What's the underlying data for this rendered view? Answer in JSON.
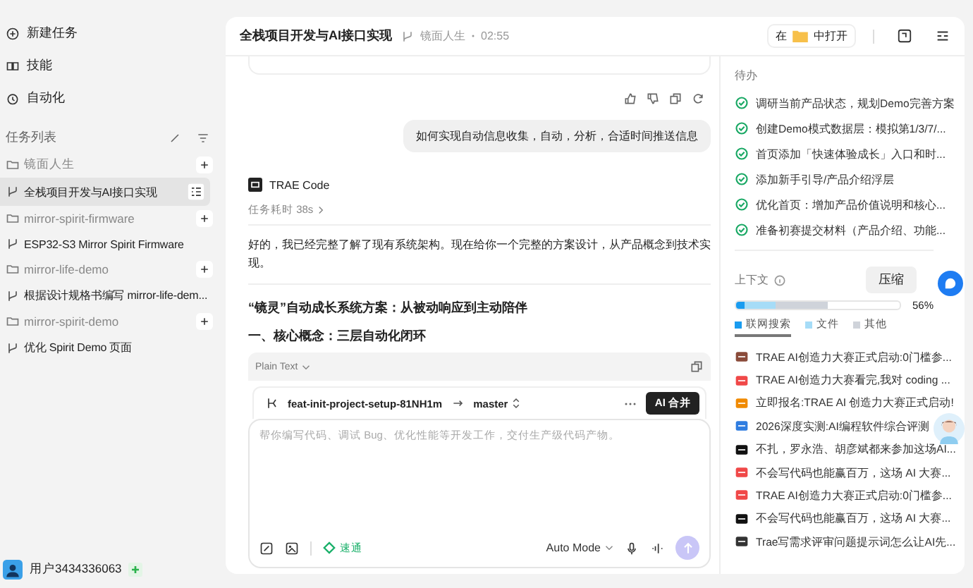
{
  "sidebar": {
    "nav": [
      {
        "label": "新建任务"
      },
      {
        "label": "技能"
      },
      {
        "label": "自动化"
      }
    ],
    "section_title": "任务列表",
    "groups": [
      {
        "name": "镜面人生",
        "tasks": [
          {
            "title": "全栈项目开发与AI接口实现",
            "selected": true
          }
        ]
      },
      {
        "name": "mirror-spirit-firmware",
        "tasks": [
          {
            "title": "ESP32-S3 Mirror Spirit Firmware",
            "selected": false
          }
        ]
      },
      {
        "name": "mirror-life-demo",
        "tasks": [
          {
            "title": "根据设计规格书编写 mirror-life-dem...",
            "selected": false
          }
        ]
      },
      {
        "name": "mirror-spirit-demo",
        "tasks": [
          {
            "title": "优化 Spirit Demo 页面",
            "selected": false
          }
        ]
      }
    ],
    "user": "用户3434336063"
  },
  "header": {
    "title": "全栈项目开发与AI接口实现",
    "project": "镜面人生",
    "time": "02:55",
    "open_in_prefix": "在",
    "open_in_suffix": "中打开"
  },
  "chat": {
    "user_message": "如何实现自动信息收集，自动，分析，合适时间推送信息",
    "agent": "TRAE Code",
    "duration": "任务耗时 38s",
    "reply": "好的，我已经完整了解了现有系统架构。现在给你一个完整的方案设计，从产品概念到技术实现。",
    "heading": "“镜灵”自动成长系统方案：从被动响应到主动陪伴",
    "subheading": "一、核心概念：三层自动化闭环",
    "code_lang": "Plain Text"
  },
  "branch_bar": {
    "branch": "feat-init-project-setup-81NH1m",
    "target": "master",
    "merge_button": "AI 合并"
  },
  "composer": {
    "placeholder": "帮你编写代码、调试 Bug、优化性能等开发工作，交付生产级代码产物。",
    "mode_chip": "速通",
    "mode": "Auto Mode"
  },
  "todos": {
    "title": "待办",
    "items": [
      {
        "text": "调研当前产品状态，规划Demo完善方案",
        "checked": true
      },
      {
        "text": "创建Demo模式数据层：模拟第1/3/7/...",
        "checked": true
      },
      {
        "text": "首页添加「快速体验成长」入口和时...",
        "checked": true
      },
      {
        "text": "添加新手引导/产品介绍浮层",
        "checked": true
      },
      {
        "text": "优化首页：增加产品价值说明和核心...",
        "checked": true
      },
      {
        "text": "准备初赛提交材料（产品介绍、功能...",
        "checked": true
      }
    ]
  },
  "context": {
    "title": "上下文",
    "compress_button": "压缩",
    "percent": "56%",
    "usage_bar": [
      {
        "color": "#1a9cf0",
        "level": 0.05
      },
      {
        "color": "#a6dcf7",
        "level": 0.19
      },
      {
        "color": "#cfd3da",
        "level": 0.32
      }
    ],
    "legend": [
      {
        "label": "联网搜索",
        "color": "#1a9cf0",
        "selected": true
      },
      {
        "label": "文件",
        "color": "#a6dcf7",
        "selected": false
      },
      {
        "label": "其他",
        "color": "#cfd3da",
        "selected": false
      }
    ],
    "sources": [
      {
        "title": "TRAE AI创造力大赛正式启动:0门槛参...",
        "color": "#8a4b3a"
      },
      {
        "title": "TRAE AI创造力大赛看完,我对 coding ...",
        "color": "#f04848"
      },
      {
        "title": "立即报名:TRAE AI 创造力大赛正式启动!",
        "color": "#f08a00"
      },
      {
        "title": "2026深度实测:AI编程软件综合评测",
        "color": "#2f7de0"
      },
      {
        "title": "不扎，罗永浩、胡彦斌都来参加这场AI...",
        "color": "#111111"
      },
      {
        "title": "不会写代码也能赢百万，这场 AI 大赛...",
        "color": "#f04848"
      },
      {
        "title": "TRAE AI创造力大赛正式启动:0门槛参...",
        "color": "#f04848"
      },
      {
        "title": "不会写代码也能赢百万，这场 AI 大赛...",
        "color": "#111111"
      },
      {
        "title": "Trae写需求评审问题提示词怎么让AI先...",
        "color": "#333333"
      }
    ]
  }
}
